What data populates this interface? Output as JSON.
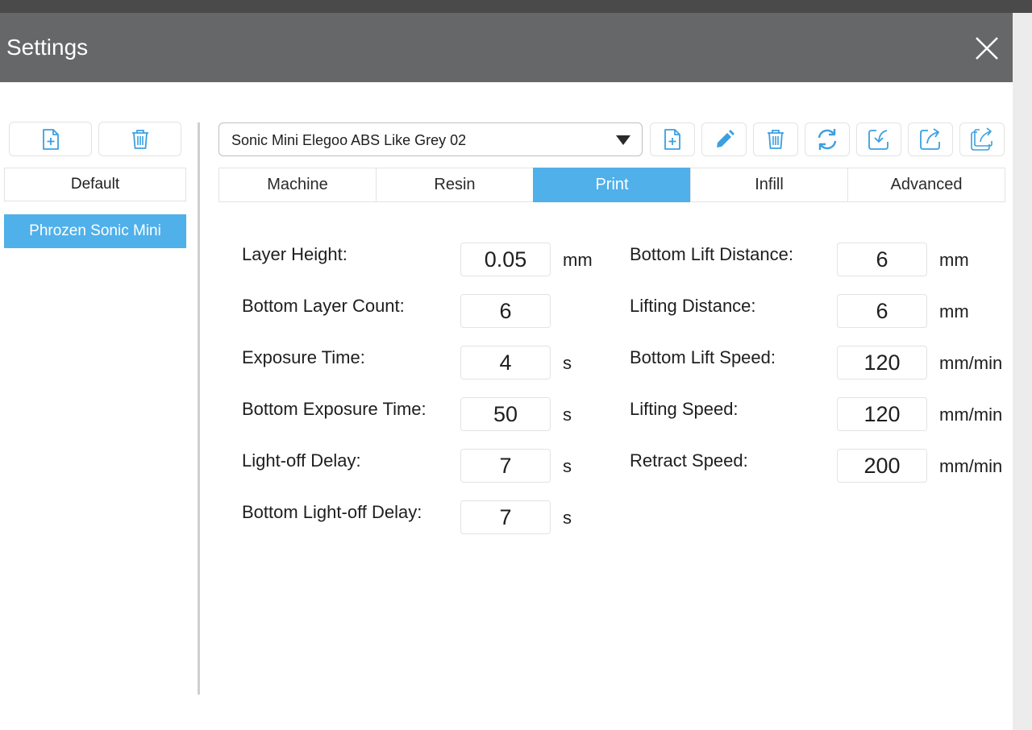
{
  "window": {
    "title": "Settings"
  },
  "sidebar": {
    "new_button_icon": "file-plus-icon",
    "delete_button_icon": "trash-icon",
    "items": [
      {
        "label": "Default",
        "selected": false
      },
      {
        "label": "Phrozen Sonic Mini",
        "selected": true
      }
    ]
  },
  "profile": {
    "selected": "Sonic Mini Elegoo ABS Like Grey 02"
  },
  "toolbar": {
    "icons": [
      "file-plus-icon",
      "pencil-icon",
      "trash-icon",
      "refresh-icon",
      "import-icon",
      "export-icon",
      "export-all-icon"
    ]
  },
  "tabs": [
    {
      "label": "Machine",
      "active": false
    },
    {
      "label": "Resin",
      "active": false
    },
    {
      "label": "Print",
      "active": true
    },
    {
      "label": "Infill",
      "active": false
    },
    {
      "label": "Advanced",
      "active": false
    }
  ],
  "print_settings": {
    "left": [
      {
        "label": "Layer Height:",
        "value": "0.05",
        "unit": "mm"
      },
      {
        "label": "Bottom Layer Count:",
        "value": "6",
        "unit": ""
      },
      {
        "label": "Exposure Time:",
        "value": "4",
        "unit": "s"
      },
      {
        "label": "Bottom Exposure Time:",
        "value": "50",
        "unit": "s"
      },
      {
        "label": "Light-off Delay:",
        "value": "7",
        "unit": "s"
      },
      {
        "label": "Bottom Light-off Delay:",
        "value": "7",
        "unit": "s"
      }
    ],
    "right": [
      {
        "label": "Bottom Lift Distance:",
        "value": "6",
        "unit": "mm"
      },
      {
        "label": "Lifting Distance:",
        "value": "6",
        "unit": "mm"
      },
      {
        "label": "Bottom Lift Speed:",
        "value": "120",
        "unit": "mm/min"
      },
      {
        "label": "Lifting Speed:",
        "value": "120",
        "unit": "mm/min"
      },
      {
        "label": "Retract Speed:",
        "value": "200",
        "unit": "mm/min"
      }
    ]
  },
  "colors": {
    "accent": "#4fb0ea",
    "icon_blue": "#3ba0e0",
    "titlebar": "#666768",
    "divider": "#cfcfcf"
  }
}
